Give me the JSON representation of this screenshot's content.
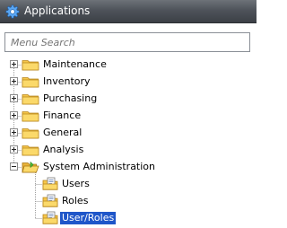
{
  "window": {
    "title": "Applications",
    "title_icon": "gear-icon"
  },
  "search": {
    "placeholder": "Menu Search",
    "value": ""
  },
  "tree": {
    "nodes": [
      {
        "label": "Maintenance",
        "expander": "plus",
        "icon": "folder-icon"
      },
      {
        "label": "Inventory",
        "expander": "plus",
        "icon": "folder-icon"
      },
      {
        "label": "Purchasing",
        "expander": "plus",
        "icon": "folder-icon"
      },
      {
        "label": "Finance",
        "expander": "plus",
        "icon": "folder-icon"
      },
      {
        "label": "General",
        "expander": "plus",
        "icon": "folder-icon"
      },
      {
        "label": "Analysis",
        "expander": "plus",
        "icon": "folder-icon"
      },
      {
        "label": "System Administration",
        "expander": "minus",
        "icon": "folder-open-icon",
        "children": [
          {
            "label": "Users",
            "icon": "menu-item-icon"
          },
          {
            "label": "Roles",
            "icon": "menu-item-icon"
          },
          {
            "label": "User/Roles",
            "icon": "menu-item-icon",
            "selected": true
          }
        ]
      }
    ]
  },
  "colors": {
    "titlebar": "#4e535a",
    "selection": "#1f56c9",
    "folder": "#f6c64a",
    "tree_line": "#a0a0a0"
  }
}
